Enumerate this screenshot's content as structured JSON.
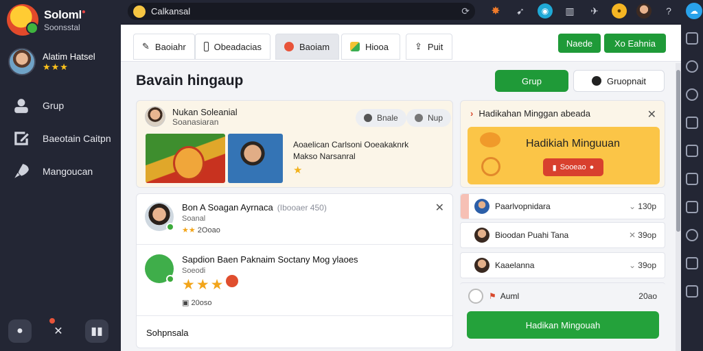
{
  "brand": {
    "name": "Soloml",
    "sub": "Soonsstal"
  },
  "profile": {
    "name": "Alatim Hatsel",
    "stars": "★★★"
  },
  "nav": [
    {
      "label": "Grup"
    },
    {
      "label": "Baeotain Caitpn"
    },
    {
      "label": "Mangoucan"
    }
  ],
  "search": {
    "value": "Calkansal"
  },
  "tabs": {
    "items": [
      {
        "label": "Baoiahr"
      },
      {
        "label": "Obeadacias"
      },
      {
        "label": "Baoiam"
      },
      {
        "label": "Hiooa"
      },
      {
        "label": "Puit"
      }
    ],
    "btn_primary": "Naede",
    "btn_secondary": "Xo Eahnia"
  },
  "page": {
    "title": "Bavain hingaup",
    "btn_grup": "Grup",
    "btn_groupnait": "Gruopnait"
  },
  "feature": {
    "name": "Nukan Soleanial",
    "sub": "Soanasiaran",
    "chip1": "Bnale",
    "chip2": "Nup",
    "text_line1": "Aoaelican Carlsoni Ooeakaknrk",
    "text_line2": "Makso Narsanral",
    "star": "★"
  },
  "list": [
    {
      "title": "Bon A Soagan Ayrnaca",
      "muted": "(Ibooaer 450)",
      "sub": "Soanal",
      "meta_stars": "★★",
      "meta_value": "2Ooao"
    },
    {
      "title": "Sapdion Baen Paknaim Soctany Mog ylaoes",
      "sub": "Soeodi",
      "stars": "★★★",
      "meta_value": "20oso"
    },
    {
      "title": "Sohpnsala"
    }
  ],
  "weekly": {
    "header": "Hadikahan Minggan abeada",
    "banner_title": "Hadikiah Minguuan",
    "btn": "Sooeao"
  },
  "rank": [
    {
      "name": "Paarlvopnidara",
      "points": "130p"
    },
    {
      "name": "Bioodan Puahi Tana",
      "points": "39op"
    },
    {
      "name": "Kaaelanna",
      "points": "39op"
    },
    {
      "name": "Auml",
      "points": "20ao"
    }
  ],
  "rank_btn": "Hadikan Mingouah"
}
